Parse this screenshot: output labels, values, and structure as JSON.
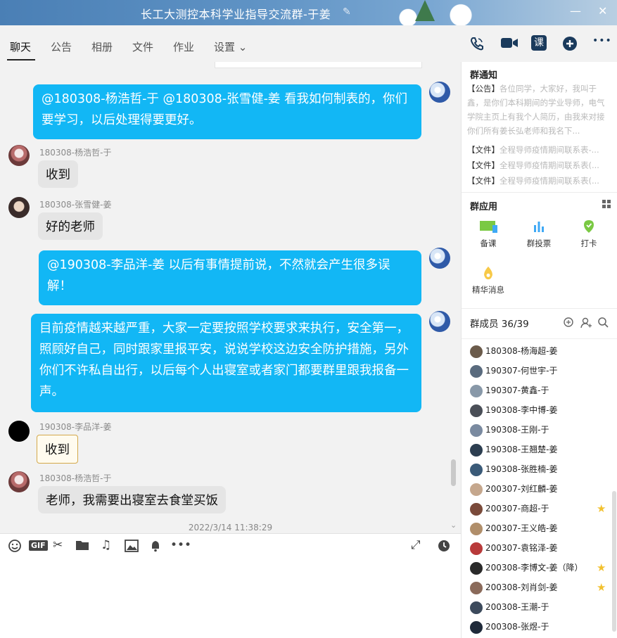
{
  "window": {
    "title": "长工大测控本科学业指导交流群-于姜",
    "edit_icon": "pencil-icon",
    "minimize": "—",
    "close": "✕"
  },
  "tabs": [
    {
      "label": "聊天",
      "active": true
    },
    {
      "label": "公告"
    },
    {
      "label": "相册"
    },
    {
      "label": "文件"
    },
    {
      "label": "作业"
    },
    {
      "label": "设置 ⌄"
    }
  ],
  "toolbar_icons": [
    "phone-icon",
    "video-icon",
    "class-icon",
    "add-icon",
    "more-icon"
  ],
  "toolbar_glyphs": {
    "class": "课",
    "more": "•••"
  },
  "messages": [
    {
      "type": "self",
      "text": "@180308-杨浩哲-于 @180308-张雪健-姜 看我如何制表的，你们要学习，以后处理得要更好。"
    },
    {
      "sender": "180308-杨浩哲-于",
      "text": "收到"
    },
    {
      "sender": "180308-张雪健-姜",
      "text": "好的老师"
    },
    {
      "type": "self",
      "text": "@190308-李品洋-姜 以后有事情提前说，不然就会产生很多误解！"
    },
    {
      "type": "self",
      "text": "目前疫情越来越严重，大家一定要按照学校要求来执行，安全第一，照顾好自己，同时跟家里报平安，说说学校这边安全防护措施，另外你们不许私自出行，以后每个人出寝室或者家门都要群里跟我报备一声。"
    },
    {
      "sender": "190308-李品洋-姜",
      "text": "收到"
    },
    {
      "sender": "180308-杨浩哲-于",
      "text": "老师，我需要出寝室去食堂买饭"
    }
  ],
  "timestamp": "2022/3/14 11:38:29",
  "input_toolbar": {
    "gif": "GIF",
    "icons": [
      "emoji-icon",
      "gif-icon",
      "scissors-icon",
      "folder-icon",
      "music-icon",
      "image-icon",
      "bell-icon",
      "more-icon",
      "expand-icon",
      "history-icon"
    ]
  },
  "sidebar": {
    "notice_title": "群通知",
    "notice_tag": "【公告】",
    "notice_text": "各位同学，大家好，我叫于鑫，是你们本科期间的学业导师，电气学院主页上有我个人简历，由我来对接你们所有姜长弘老师和我名下...",
    "files": [
      {
        "tag": "【文件】",
        "name": "全程导师疫情期间联系表-..."
      },
      {
        "tag": "【文件】",
        "name": "全程导师疫情期间联系表(..."
      },
      {
        "tag": "【文件】",
        "name": "全程导师疫情期间联系表(..."
      }
    ],
    "apps_title": "群应用",
    "apps": [
      "备课",
      "群投票",
      "打卡",
      "精华消息"
    ],
    "members_title": "群成员 36/39",
    "members": [
      {
        "name": "180308-杨海超-姜",
        "color": "#6b5b4b"
      },
      {
        "name": "190307-何世宇-于",
        "color": "#5a6b7e"
      },
      {
        "name": "190307-黄鑫-于",
        "color": "#8898a8"
      },
      {
        "name": "190308-李中博-姜",
        "color": "#4a4f57"
      },
      {
        "name": "190308-王刚-于",
        "color": "#7a8aa0"
      },
      {
        "name": "190308-王翘楚-姜",
        "color": "#2c3e50"
      },
      {
        "name": "190308-张胜楠-姜",
        "color": "#3a5a78"
      },
      {
        "name": "200307-刘红麟-姜",
        "color": "#c5a78d"
      },
      {
        "name": "200307-商超-于",
        "color": "#7a4a3a",
        "star": true
      },
      {
        "name": "200307-王义皓-姜",
        "color": "#b08e6a"
      },
      {
        "name": "200307-袁铭泽-姜",
        "color": "#b83a3a"
      },
      {
        "name": "200308-李博文-姜（降）",
        "color": "#2a2a2a",
        "star": true
      },
      {
        "name": "200308-刘肖剑-姜",
        "color": "#8a6a5a",
        "star": true
      },
      {
        "name": "200308-王潮-于",
        "color": "#3c4a5c"
      },
      {
        "name": "200308-张煜-于",
        "color": "#1f2a3a"
      }
    ]
  }
}
